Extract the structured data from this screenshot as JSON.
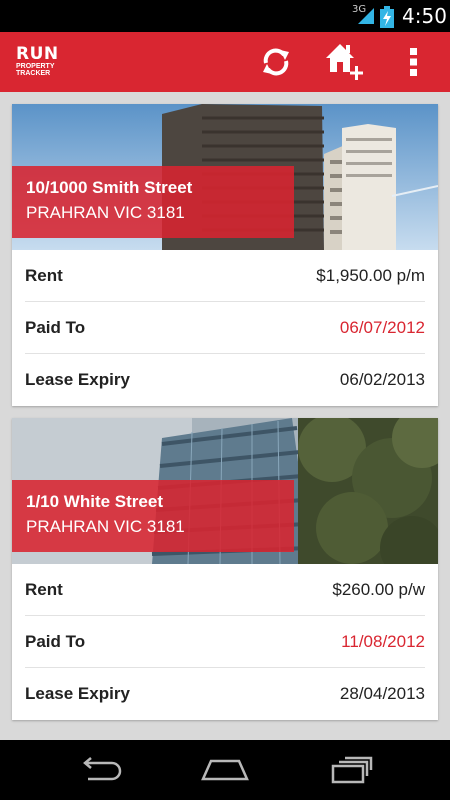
{
  "status_bar": {
    "network": "3G",
    "time": "4:50"
  },
  "app": {
    "logo_main": "RUN",
    "logo_sub": "PROPERTY TRACKER",
    "actions": [
      {
        "icon": "refresh-icon"
      },
      {
        "icon": "add-home-icon"
      },
      {
        "icon": "overflow-menu-icon"
      }
    ]
  },
  "properties": [
    {
      "street": "10/1000 Smith Street",
      "suburb": "PRAHRAN VIC 3181",
      "rows": [
        {
          "label": "Rent",
          "value": "$1,950.00 p/m"
        },
        {
          "label": "Paid To",
          "value": "06/07/2012"
        },
        {
          "label": "Lease Expiry",
          "value": "06/02/2013"
        }
      ]
    },
    {
      "street": "1/10 White Street",
      "suburb": "PRAHRAN VIC 3181",
      "rows": [
        {
          "label": "Rent",
          "value": "$260.00 p/w"
        },
        {
          "label": "Paid To",
          "value": "11/08/2012"
        },
        {
          "label": "Lease Expiry",
          "value": "28/04/2013"
        }
      ]
    }
  ],
  "colors": {
    "brand": "#d92631",
    "overdue": "#d92631"
  },
  "nav": [
    {
      "icon": "back-icon"
    },
    {
      "icon": "home-icon"
    },
    {
      "icon": "recent-apps-icon"
    }
  ]
}
